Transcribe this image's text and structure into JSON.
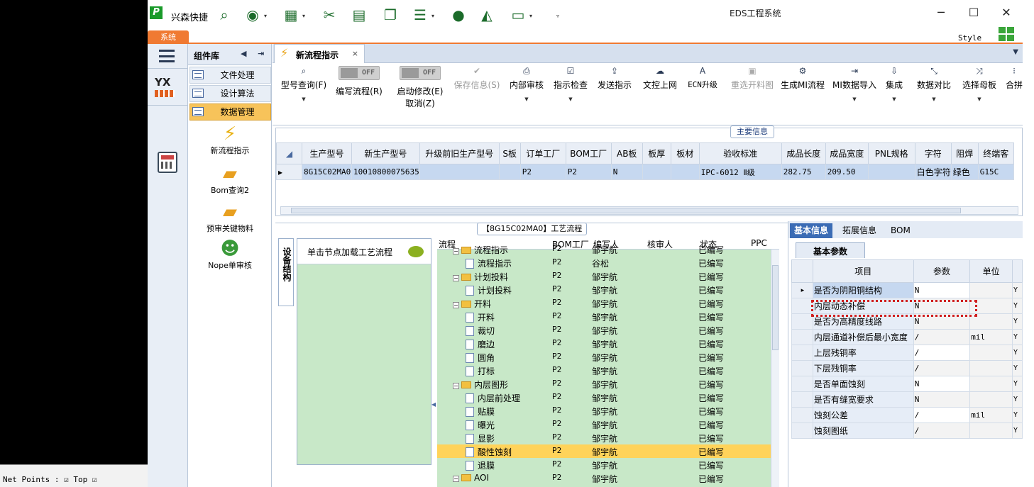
{
  "app": {
    "name": "兴森快捷",
    "window_title": "EDS工程系统",
    "style_label": "Style",
    "system_tab": "系统"
  },
  "bottom_text": "Net Points : ☑ Top  ☑",
  "components": {
    "title": "组件库",
    "items": [
      {
        "label": "文件处理"
      },
      {
        "label": "设计算法"
      },
      {
        "label": "数据管理"
      }
    ],
    "subitems": [
      {
        "label": "新流程指示",
        "icon": "bolt-icon"
      },
      {
        "label": "Bom查询2",
        "icon": "folder-icon"
      },
      {
        "label": "预审关键物料",
        "icon": "folder-icon"
      },
      {
        "label": "Nope单审核",
        "icon": "person-icon"
      }
    ]
  },
  "doc_tab": {
    "label": "新流程指示",
    "close": "×"
  },
  "ribbon": {
    "model_query": "型号查询(F)",
    "write_flow": "编写流程(R)",
    "start_modify": "启动修改(E)",
    "cancel": "取消(Z)",
    "toggle_off": "OFF",
    "save_info": "保存信息(S)",
    "internal_review": "内部审核",
    "instruction_check": "指示检查",
    "send_instruction": "发送指示",
    "doc_upload": "文控上网",
    "ecn_upgrade": "ECN升级",
    "reselect_cut": "重选开料图",
    "gen_mi": "生成MI流程",
    "mi_import": "MI数据导入",
    "integrate": "集成",
    "data_compare": "数据对比",
    "select_mother": "选择母板",
    "combine": "合拼"
  },
  "main_info": {
    "section_label": "主要信息",
    "columns": [
      "生产型号",
      "新生产型号",
      "升级前旧生产型号",
      "S板",
      "订单工厂",
      "BOM工厂",
      "AB板",
      "板厚",
      "板材",
      "验收标准",
      "成品长度",
      "成品宽度",
      "PNL规格",
      "字符",
      "阻焊",
      "终端客"
    ],
    "row": [
      "8G15C02MA0",
      "10010800075635",
      "",
      "",
      "P2",
      "P2",
      "N",
      "",
      "",
      "IPC-6012 Ⅱ级",
      "282.75",
      "209.50",
      "",
      "白色字符",
      "绿色",
      "G15C"
    ]
  },
  "equip": {
    "vertical_label": "设备结构",
    "hint": "单击节点加载工艺流程"
  },
  "process": {
    "tag": "【8G15C02MA0】工艺流程",
    "headers": {
      "flow": "流程",
      "bom": "BOM工厂",
      "writer": "编写人",
      "reviewer": "核审人",
      "status": "状态",
      "ppc": "PPC"
    },
    "rows": [
      {
        "name": "流程指示",
        "bom": "P2",
        "writer": "邹宇航",
        "status": "已编写",
        "level": 0
      },
      {
        "name": "流程指示",
        "bom": "P2",
        "writer": "谷松",
        "status": "已编写",
        "level": 1
      },
      {
        "name": "计划投料",
        "bom": "P2",
        "writer": "邹宇航",
        "status": "已编写",
        "level": 0
      },
      {
        "name": "计划投料",
        "bom": "P2",
        "writer": "邹宇航",
        "status": "已编写",
        "level": 1
      },
      {
        "name": "开料",
        "bom": "P2",
        "writer": "邹宇航",
        "status": "已编写",
        "level": 0
      },
      {
        "name": "开料",
        "bom": "P2",
        "writer": "邹宇航",
        "status": "已编写",
        "level": 1
      },
      {
        "name": "裁切",
        "bom": "P2",
        "writer": "邹宇航",
        "status": "已编写",
        "level": 1
      },
      {
        "name": "磨边",
        "bom": "P2",
        "writer": "邹宇航",
        "status": "已编写",
        "level": 1
      },
      {
        "name": "圆角",
        "bom": "P2",
        "writer": "邹宇航",
        "status": "已编写",
        "level": 1
      },
      {
        "name": "打标",
        "bom": "P2",
        "writer": "邹宇航",
        "status": "已编写",
        "level": 1
      },
      {
        "name": "内层图形",
        "bom": "P2",
        "writer": "邹宇航",
        "status": "已编写",
        "level": 0
      },
      {
        "name": "内层前处理",
        "bom": "P2",
        "writer": "邹宇航",
        "status": "已编写",
        "level": 1
      },
      {
        "name": "贴膜",
        "bom": "P2",
        "writer": "邹宇航",
        "status": "已编写",
        "level": 1
      },
      {
        "name": "曝光",
        "bom": "P2",
        "writer": "邹宇航",
        "status": "已编写",
        "level": 1
      },
      {
        "name": "显影",
        "bom": "P2",
        "writer": "邹宇航",
        "status": "已编写",
        "level": 1
      },
      {
        "name": "酸性蚀刻",
        "bom": "P2",
        "writer": "邹宇航",
        "status": "已编写",
        "level": 1,
        "selected": true
      },
      {
        "name": "退膜",
        "bom": "P2",
        "writer": "邹宇航",
        "status": "已编写",
        "level": 1
      },
      {
        "name": "AOI",
        "bom": "P2",
        "writer": "邹宇航",
        "status": "已编写",
        "level": 0
      }
    ]
  },
  "props": {
    "tabs": [
      "基本信息",
      "拓展信息",
      "BOM"
    ],
    "subtab": "基本参数",
    "headers": {
      "item": "项目",
      "param": "参数",
      "unit": "单位"
    },
    "rows": [
      {
        "item": "是否为阴阳铜结构",
        "param": "N",
        "unit": "",
        "flag": "Y"
      },
      {
        "item": "内层动态补偿",
        "param": "N",
        "unit": "",
        "flag": "Y"
      },
      {
        "item": "是否为高精度线路",
        "param": "N",
        "unit": "",
        "flag": "Y"
      },
      {
        "item": "内层通道补偿后最小宽度",
        "param": "/",
        "unit": "mil",
        "flag": "Y"
      },
      {
        "item": "上层残铜率",
        "param": "/",
        "unit": "",
        "flag": "Y"
      },
      {
        "item": "下层残铜率",
        "param": "/",
        "unit": "",
        "flag": "Y"
      },
      {
        "item": "是否单面蚀刻",
        "param": "N",
        "unit": "",
        "flag": "Y"
      },
      {
        "item": "是否有缝宽要求",
        "param": "N",
        "unit": "",
        "flag": "Y"
      },
      {
        "item": "蚀刻公差",
        "param": "/",
        "unit": "mil",
        "flag": "Y"
      },
      {
        "item": "蚀刻图纸",
        "param": "/",
        "unit": "",
        "flag": "Y"
      }
    ]
  }
}
